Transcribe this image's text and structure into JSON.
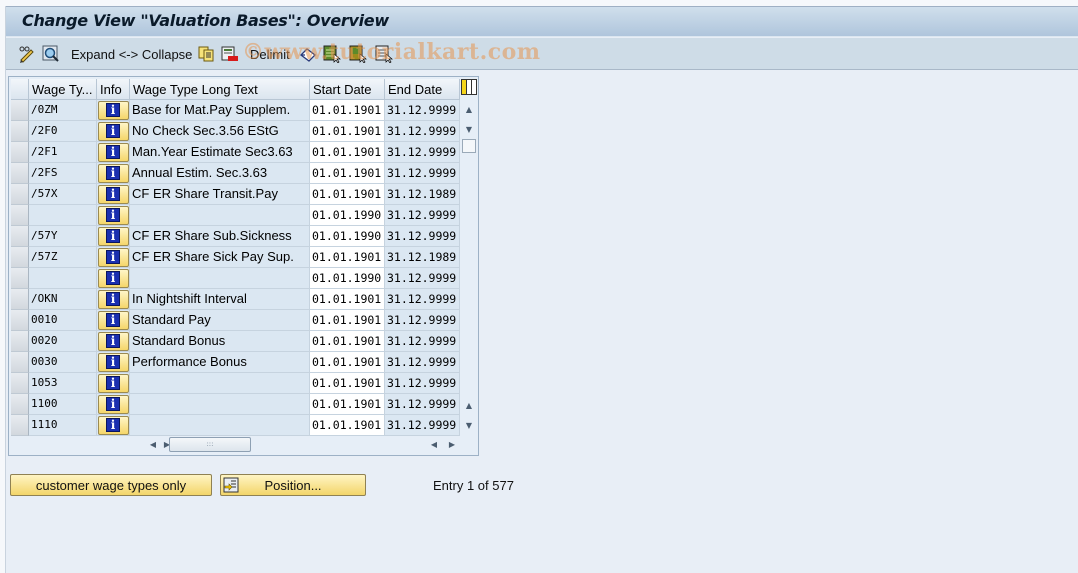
{
  "window": {
    "title": "Change View \"Valuation Bases\": Overview"
  },
  "toolbar": {
    "items": [
      {
        "name": "change-display-icon",
        "type": "icon"
      },
      {
        "name": "details-icon",
        "type": "icon"
      },
      {
        "name": "expand-collapse",
        "type": "text",
        "label": "Expand <-> Collapse"
      },
      {
        "name": "copy-as-icon",
        "type": "icon"
      },
      {
        "name": "delete-icon",
        "type": "icon"
      },
      {
        "name": "delimit",
        "type": "text",
        "label": "Delimit"
      },
      {
        "name": "undo-change-icon",
        "type": "icon"
      },
      {
        "name": "select-all-icon",
        "type": "icon"
      },
      {
        "name": "select-block-icon",
        "type": "icon"
      },
      {
        "name": "deselect-all-icon",
        "type": "icon"
      }
    ],
    "watermark": "©www.tutorialkart.com"
  },
  "table": {
    "columns": [
      "Wage Ty...",
      "Info",
      "Wage Type Long Text",
      "Start Date",
      "End Date"
    ],
    "info_glyph": "i",
    "rows": [
      {
        "wage_type": "/0ZM",
        "text": "Base for Mat.Pay Supplem.",
        "start": "01.01.1901",
        "end": "31.12.9999"
      },
      {
        "wage_type": "/2F0",
        "text": "No Check Sec.3.56 EStG",
        "start": "01.01.1901",
        "end": "31.12.9999"
      },
      {
        "wage_type": "/2F1",
        "text": "Man.Year Estimate Sec3.63",
        "start": "01.01.1901",
        "end": "31.12.9999"
      },
      {
        "wage_type": "/2FS",
        "text": "Annual Estim. Sec.3.63",
        "start": "01.01.1901",
        "end": "31.12.9999"
      },
      {
        "wage_type": "/57X",
        "text": "CF ER Share Transit.Pay",
        "start": "01.01.1901",
        "end": "31.12.1989"
      },
      {
        "wage_type": "",
        "text": "",
        "start": "01.01.1990",
        "end": "31.12.9999"
      },
      {
        "wage_type": "/57Y",
        "text": "CF ER Share Sub.Sickness",
        "start": "01.01.1990",
        "end": "31.12.9999"
      },
      {
        "wage_type": "/57Z",
        "text": "CF ER Share Sick Pay Sup.",
        "start": "01.01.1901",
        "end": "31.12.1989"
      },
      {
        "wage_type": "",
        "text": "",
        "start": "01.01.1990",
        "end": "31.12.9999"
      },
      {
        "wage_type": "/OKN",
        "text": "In Nightshift Interval",
        "start": "01.01.1901",
        "end": "31.12.9999"
      },
      {
        "wage_type": "0010",
        "text": "Standard Pay",
        "start": "01.01.1901",
        "end": "31.12.9999"
      },
      {
        "wage_type": "0020",
        "text": "Standard Bonus",
        "start": "01.01.1901",
        "end": "31.12.9999"
      },
      {
        "wage_type": "0030",
        "text": "Performance Bonus",
        "start": "01.01.1901",
        "end": "31.12.9999"
      },
      {
        "wage_type": "1053",
        "text": "",
        "start": "01.01.1901",
        "end": "31.12.9999"
      },
      {
        "wage_type": "1100",
        "text": "",
        "start": "01.01.1901",
        "end": "31.12.9999"
      },
      {
        "wage_type": "1110",
        "text": "",
        "start": "01.01.1901",
        "end": "31.12.9999"
      }
    ],
    "scroll_glyphs": {
      "up": "▲",
      "down": "▼",
      "left": "◀",
      "right": "▶",
      "grip": ":::"
    }
  },
  "footer": {
    "customer_button": "customer wage types only",
    "position_button": "Position...",
    "entry_text": "Entry 1 of 577"
  }
}
